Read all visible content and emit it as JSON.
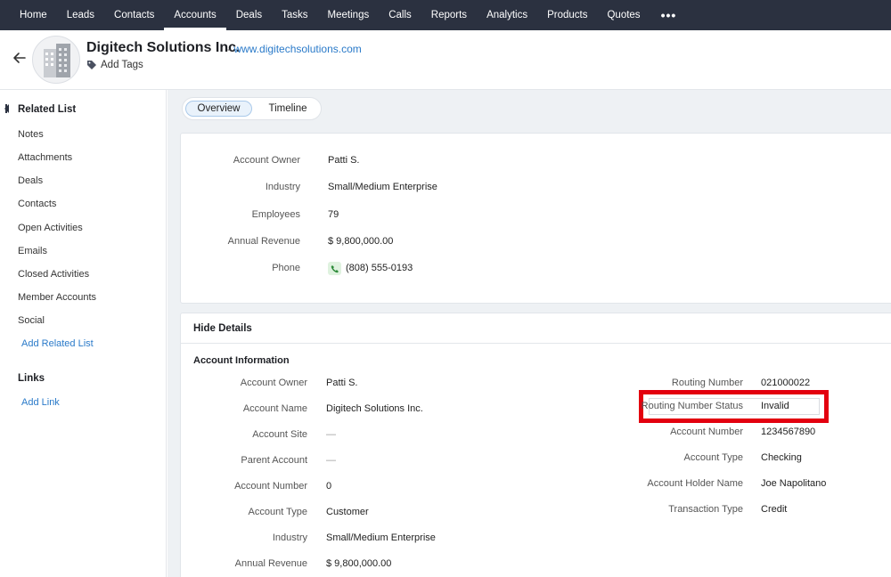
{
  "nav": {
    "tabs": [
      "Home",
      "Leads",
      "Contacts",
      "Accounts",
      "Deals",
      "Tasks",
      "Meetings",
      "Calls",
      "Reports",
      "Analytics",
      "Products",
      "Quotes"
    ],
    "active": "Accounts",
    "more_icon": "more-horizontal-icon"
  },
  "header": {
    "account_name": "Digitech Solutions Inc.",
    "separator": "-",
    "website": "www.digitechsolutions.com",
    "add_tags": "Add Tags"
  },
  "sidebar": {
    "related_title": "Related List",
    "items": [
      "Notes",
      "Attachments",
      "Deals",
      "Contacts",
      "Open Activities",
      "Emails",
      "Closed Activities",
      "Member Accounts",
      "Social"
    ],
    "add_related": "Add Related List",
    "links_title": "Links",
    "add_link": "Add Link"
  },
  "view_tabs": {
    "overview": "Overview",
    "timeline": "Timeline"
  },
  "summary": {
    "rows": [
      {
        "label": "Account Owner",
        "value": "Patti S."
      },
      {
        "label": "Industry",
        "value": "Small/Medium Enterprise"
      },
      {
        "label": "Employees",
        "value": "79"
      },
      {
        "label": "Annual Revenue",
        "value": "$ 9,800,000.00"
      },
      {
        "label": "Phone",
        "value": "(808) 555-0193"
      }
    ]
  },
  "details": {
    "hide_label": "Hide Details",
    "section_title": "Account Information",
    "left": [
      {
        "label": "Account Owner",
        "value": "Patti S."
      },
      {
        "label": "Account Name",
        "value": "Digitech Solutions Inc."
      },
      {
        "label": "Account Site",
        "value": "—"
      },
      {
        "label": "Parent Account",
        "value": "—"
      },
      {
        "label": "Account Number",
        "value": "0"
      },
      {
        "label": "Account Type",
        "value": "Customer"
      },
      {
        "label": "Industry",
        "value": "Small/Medium Enterprise"
      },
      {
        "label": "Annual Revenue",
        "value": "$ 9,800,000.00"
      }
    ],
    "right": [
      {
        "label": "Routing Number",
        "value": "021000022"
      },
      {
        "label": "Routing Number Status",
        "value": "Invalid"
      },
      {
        "label": "Account Number",
        "value": "1234567890"
      },
      {
        "label": "Account Type",
        "value": "Checking"
      },
      {
        "label": "Account Holder Name",
        "value": "Joe Napolitano"
      },
      {
        "label": "Transaction Type",
        "value": "Credit"
      }
    ]
  },
  "colors": {
    "nav_bg": "#2b3140",
    "link": "#2a7ac9",
    "highlight": "#e3000f"
  }
}
